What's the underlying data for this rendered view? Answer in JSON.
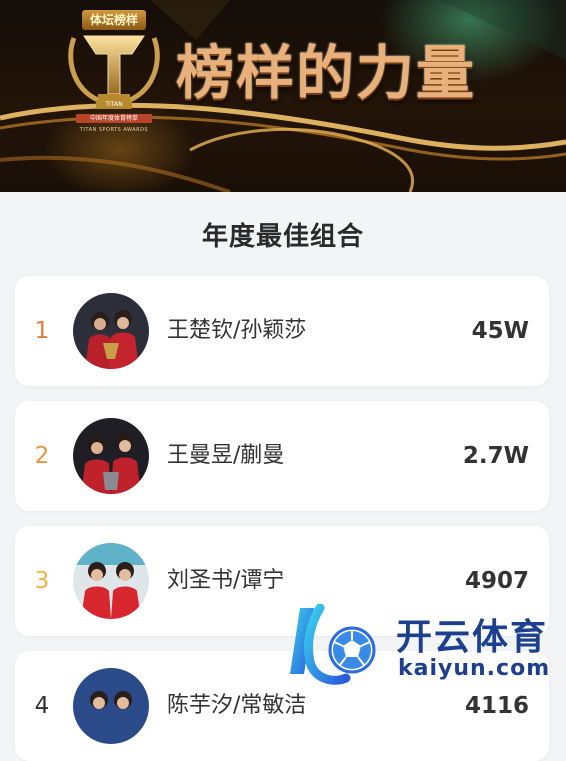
{
  "banner": {
    "badge_title": "体坛榜样",
    "badge_brand": "TITAN",
    "badge_cn": "中国年度体育榜单",
    "badge_en": "TITAN SPORTS AWARDS",
    "slogan": "榜样的力量"
  },
  "section": {
    "title": "年度最佳组合"
  },
  "rankings": [
    {
      "rank": "1",
      "names": "王楚钦/孙颖莎",
      "votes": "45W",
      "rank_color": "#e67a3a"
    },
    {
      "rank": "2",
      "names": "王曼昱/蒯曼",
      "votes": "2.7W",
      "rank_color": "#e8963e"
    },
    {
      "rank": "3",
      "names": "刘圣书/谭宁",
      "votes": "4907",
      "rank_color": "#f0b441"
    },
    {
      "rank": "4",
      "names": "陈芋汐/常敏洁",
      "votes": "4116",
      "rank_color": "#333333"
    }
  ],
  "watermark": {
    "cn": "开云体育",
    "en": "kaiyun.com"
  },
  "colors": {
    "gold": "#c99a44",
    "accent_blue": "#1d3f8f",
    "card_bg": "#ffffff",
    "page_bg": "#f3f4f6"
  }
}
